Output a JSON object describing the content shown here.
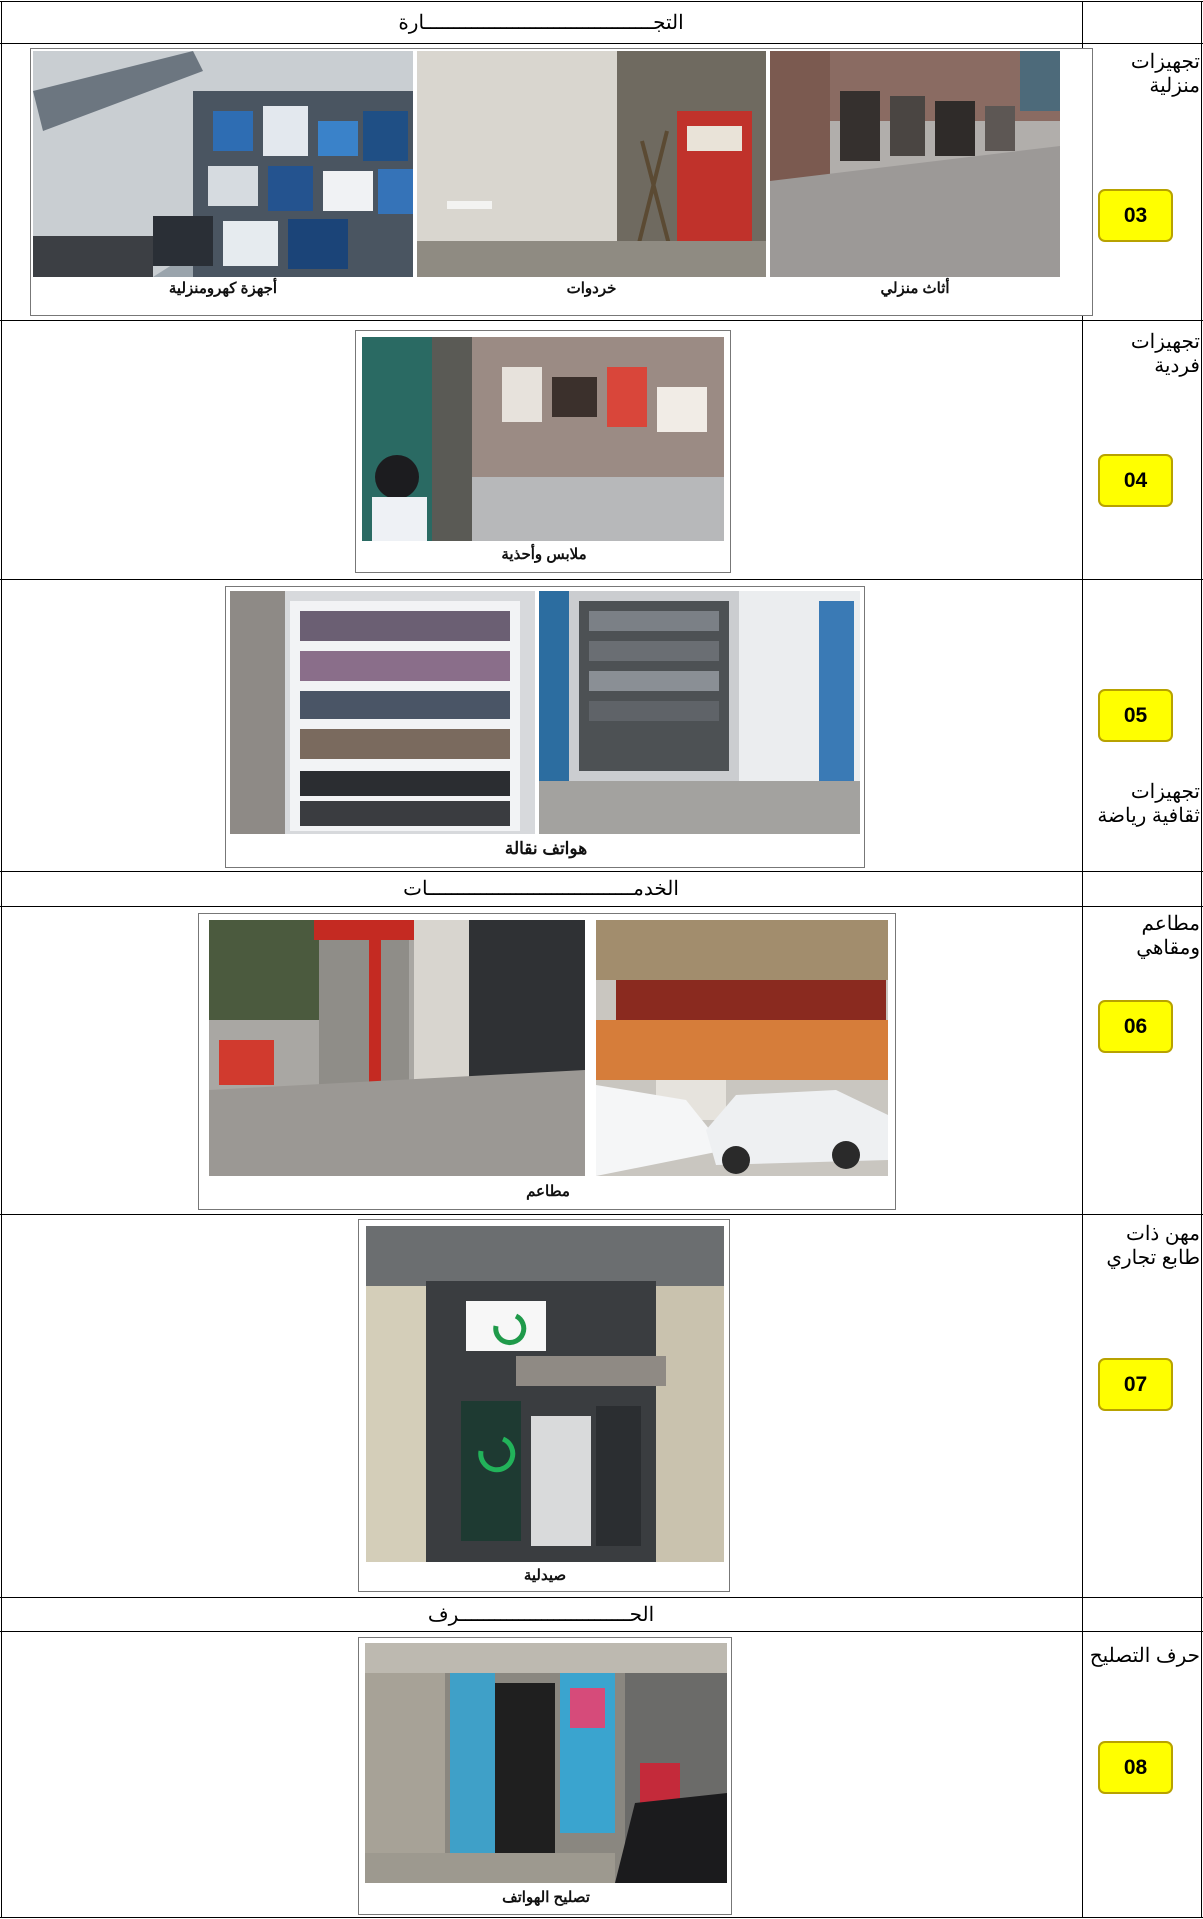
{
  "sections": {
    "commerce": "التجـــــــــــــــــــــــــــــــــــــــارة",
    "services": "الخدمـــــــــــــــــــــــــــــــــــات",
    "crafts": "الحـــــــــــــــــــــــــــــرف"
  },
  "rows": [
    {
      "category": "تجهيزات منزلية",
      "number": "03",
      "captions": [
        "أجهزة كهرومنزلية",
        "خردوات",
        "أثاث منزلي"
      ]
    },
    {
      "category": "تجهيزات فردية",
      "number": "04",
      "captions": [
        "ملابس وأحذية"
      ]
    },
    {
      "category": "تجهيزات ثقافية رياضة",
      "number": "05",
      "captions": [
        "هواتف نقالة"
      ]
    },
    {
      "category": "مطاعم ومقاهي",
      "number": "06",
      "captions": [
        "مطاعم"
      ]
    },
    {
      "category": "مهن ذات طابع تجاري",
      "number": "07",
      "captions": [
        "صيدلية"
      ]
    },
    {
      "category": "حرف التصليح",
      "number": "08",
      "captions": [
        "تصليح الهواتف"
      ]
    }
  ]
}
